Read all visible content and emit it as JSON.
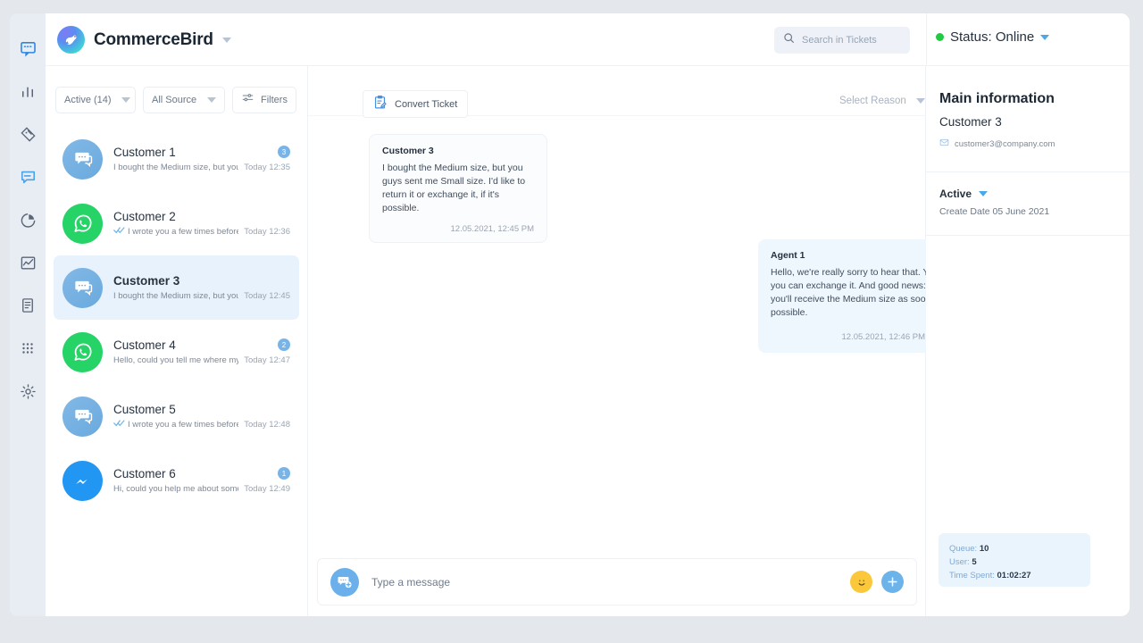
{
  "rail": {
    "items": [
      {
        "name": "inbox-icon",
        "label": "Inbox",
        "active": true
      },
      {
        "name": "bar-chart-icon",
        "label": "Statistics",
        "active": false
      },
      {
        "name": "tickets-icon",
        "label": "Tickets",
        "active": false
      },
      {
        "name": "chat-icon",
        "label": "Chat",
        "active": true
      },
      {
        "name": "pie-chart-icon",
        "label": "Reports",
        "active": false
      },
      {
        "name": "line-chart-icon",
        "label": "Analytics",
        "active": false
      },
      {
        "name": "document-icon",
        "label": "Documents",
        "active": false
      },
      {
        "name": "grid-apps-icon",
        "label": "Apps",
        "active": false
      },
      {
        "name": "gear-icon",
        "label": "Settings",
        "active": false
      }
    ]
  },
  "header": {
    "brand_name": "CommerceBird",
    "brand_caret": "brand-dropdown-caret",
    "search": {
      "placeholder": "Search in Tickets",
      "icon": "search-icon"
    },
    "status": {
      "text": "Status: Online",
      "dot_color": "#22c943",
      "caret": "status-dropdown-caret"
    }
  },
  "list_panel": {
    "filters": [
      {
        "label": "Active (14)",
        "type": "dropdown",
        "name": "filter-active"
      },
      {
        "label": "All Source",
        "type": "dropdown",
        "name": "filter-source"
      },
      {
        "label": "Filters",
        "type": "button",
        "name": "filter-more",
        "icon": "sliders-icon"
      }
    ],
    "conversations": [
      {
        "name": "Customer 1",
        "preview": "I bought the Medium size, but you guys...",
        "time": "Today 12:35",
        "badge": "3",
        "avatar": "chat",
        "read_ticks": false,
        "active": false
      },
      {
        "name": "Customer 2",
        "preview": "I wrote you a few times before for...",
        "time": "Today 12:36",
        "badge": "",
        "avatar": "whatsapp",
        "read_ticks": true,
        "active": false
      },
      {
        "name": "Customer 3",
        "preview": "I bought the Medium size, but you...",
        "time": "Today 12:45",
        "badge": "",
        "avatar": "chat",
        "read_ticks": false,
        "active": true
      },
      {
        "name": "Customer 4",
        "preview": "Hello, could you tell me where my...",
        "time": "Today 12:47",
        "badge": "2",
        "avatar": "whatsapp",
        "read_ticks": false,
        "active": false
      },
      {
        "name": "Customer 5",
        "preview": "I wrote you a few times before for...",
        "time": "Today 12:48",
        "badge": "",
        "avatar": "chat",
        "read_ticks": true,
        "active": false
      },
      {
        "name": "Customer 6",
        "preview": "Hi, could you help me about something?",
        "time": "Today 12:49",
        "badge": "1",
        "avatar": "messenger",
        "read_ticks": false,
        "active": false
      }
    ]
  },
  "chat_panel": {
    "toolbar": {
      "convert_label": "Convert Ticket",
      "convert_icon": "clipboard-edit-icon",
      "reason_label": "Select Reason",
      "reason_caret": "reason-dropdown-caret",
      "confirm_icon": "check-icon",
      "confirm_color": "#53d9a6"
    },
    "messages": [
      {
        "author": "Customer 3",
        "text": "I bought the Medium size, but you guys sent me Small size. I'd like to return it or exchange it, if it's possible.",
        "time": "12.05.2021, 12:45 PM",
        "direction": "in",
        "read_ticks": false
      },
      {
        "author": "Agent 1",
        "text": "Hello, we're really sorry to hear that. Yes, you can exchange it. And good news: you'll receive the Medium size as soon as possible.",
        "time": "12.05.2021, 12:46 PM",
        "direction": "out",
        "read_ticks": true
      }
    ],
    "composer": {
      "placeholder": "Type a message",
      "value": "",
      "avatar_icon": "new-message-icon",
      "emoji_icon": "smiley-icon",
      "add_icon": "plus-icon"
    }
  },
  "info_panel": {
    "main_title": "Main information",
    "customer_name": "Customer 3",
    "email": "customer3@company.com",
    "email_icon": "mail-icon",
    "state_label": "Active",
    "state_caret": "state-dropdown-caret",
    "create_date": "Create Date 05 June 2021",
    "stats": {
      "queue_key": "Queue:",
      "queue_value": "10",
      "user_key": "User:",
      "user_value": "5",
      "time_key": "Time Spent:",
      "time_value": "01:02:27"
    }
  }
}
